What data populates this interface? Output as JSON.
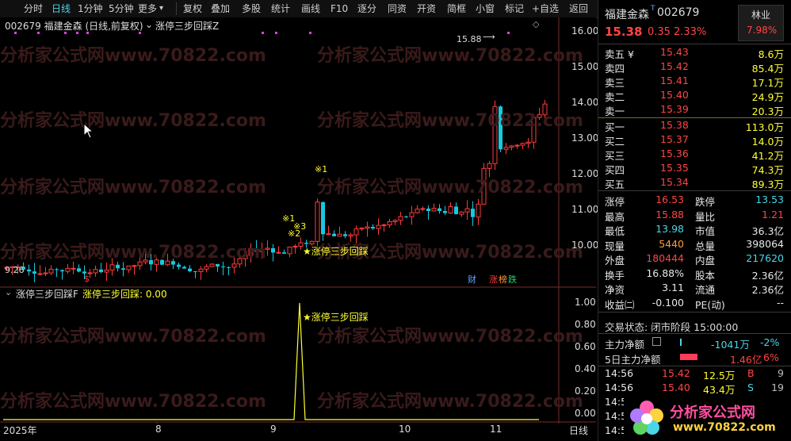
{
  "toolbar": {
    "items": [
      "分时",
      "日线",
      "1分钟",
      "5分钟",
      "更多",
      "复权",
      "叠加",
      "多股",
      "统计",
      "画线",
      "F10",
      "逐分",
      "同资",
      "开资",
      "简框",
      "小窗",
      "标记",
      "+自选",
      "返回"
    ],
    "more_arrow": "▾",
    "active_index": 1
  },
  "chart": {
    "header": "002679 福建金森 (日线,前复权)",
    "indicator_name": "涨停三步回踩Z",
    "dots_symbol": "◇",
    "y_ticks": [
      "16.00",
      "15.00",
      "14.00",
      "13.00",
      "12.00",
      "11.00",
      "10.00"
    ],
    "high_mark": "15.88",
    "low_mark": "9.26",
    "markers": {
      "m1a": "※1",
      "m1b": "※1",
      "m2": "※2",
      "m3": "※3",
      "star_label": "★涨停三步回踩",
      "s_mark": "$"
    },
    "tags": {
      "cai": "财",
      "zhang": "涨",
      "bang": "榜",
      "die": "跌"
    },
    "watermark": "分析家公式网www.70822.com"
  },
  "sub": {
    "title": "涨停三步回踩F",
    "value_label": "涨停三步回踩: 0.00",
    "y_ticks": [
      "1.00",
      "0.80",
      "0.60",
      "0.40",
      "0.20",
      "0.00"
    ],
    "star_label": "★涨停三步回踩"
  },
  "xaxis": {
    "labels": [
      "2025年",
      "8",
      "9",
      "10",
      "11"
    ],
    "mode": "日线"
  },
  "stock": {
    "name": "福建金森",
    "badge": "T",
    "code": "002679",
    "sector": "林业",
    "sector_pct": "7.98%",
    "price": "15.38",
    "change": "0.35",
    "pct": "2.33%"
  },
  "orderbook": {
    "asks": [
      {
        "label": "卖五 ¥",
        "price": "15.43",
        "vol": "8.6万"
      },
      {
        "label": "卖四",
        "price": "15.42",
        "vol": "85.4万"
      },
      {
        "label": "卖三",
        "price": "15.41",
        "vol": "17.1万"
      },
      {
        "label": "卖二",
        "price": "15.40",
        "vol": "24.9万"
      },
      {
        "label": "卖一",
        "price": "15.39",
        "vol": "20.3万"
      }
    ],
    "bids": [
      {
        "label": "买一",
        "price": "15.38",
        "vol": "113.0万"
      },
      {
        "label": "买二",
        "price": "15.37",
        "vol": "14.0万"
      },
      {
        "label": "买三",
        "price": "15.36",
        "vol": "41.2万"
      },
      {
        "label": "买四",
        "price": "15.35",
        "vol": "74.3万"
      },
      {
        "label": "买五",
        "price": "15.34",
        "vol": "89.3万"
      }
    ]
  },
  "stats": [
    {
      "l1": "涨停",
      "v1": "16.53",
      "c1": "red",
      "l2": "跌停",
      "v2": "13.53",
      "c2": "cyan"
    },
    {
      "l1": "最高",
      "v1": "15.88",
      "c1": "red",
      "l2": "量比",
      "v2": "1.21",
      "c2": "red"
    },
    {
      "l1": "最低",
      "v1": "13.98",
      "c1": "cyan",
      "l2": "市值",
      "v2": "36.3亿",
      "c2": "white"
    },
    {
      "l1": "现量",
      "v1": "5440",
      "c1": "orange",
      "l2": "总量",
      "v2": "398064",
      "c2": "white"
    },
    {
      "l1": "外盘",
      "v1": "180444",
      "c1": "red",
      "l2": "内盘",
      "v2": "217620",
      "c2": "cyan"
    },
    {
      "l1": "换手",
      "v1": "16.88%",
      "c1": "white",
      "l2": "股本",
      "v2": "2.36亿",
      "c2": "white"
    },
    {
      "l1": "净资",
      "v1": "3.11",
      "c1": "white",
      "l2": "流通",
      "v2": "2.36亿",
      "c2": "white"
    },
    {
      "l1": "收益㈡",
      "v1": "-0.100",
      "c1": "white",
      "l2": "PE(动)",
      "v2": "--",
      "c2": "white"
    }
  ],
  "status": "交易状态: 闭市阶段 15:00:00",
  "fund": {
    "main_label": "主力净额",
    "main_val": "-1041万",
    "main_pct": "-2%",
    "five_label": "5日主力净额",
    "five_val": "1.46亿",
    "five_pct": "6%"
  },
  "ticks": [
    {
      "time": "14:56",
      "price": "15.42",
      "vol": "12.5万",
      "side": "B",
      "n": "9"
    },
    {
      "time": "14:56",
      "price": "15.40",
      "vol": "43.4万",
      "side": "S",
      "n": "19"
    },
    {
      "time": "14:5",
      "price": "",
      "vol": "",
      "side": "",
      "n": ""
    },
    {
      "time": "14:5",
      "price": "",
      "vol": "",
      "side": "",
      "n": ""
    },
    {
      "time": "14:5",
      "price": "",
      "vol": "",
      "side": "",
      "n": ""
    }
  ],
  "logo": {
    "text": "分析家公式网",
    "url": "www.70822.com"
  },
  "colors": {
    "up": "#ff3b3b",
    "down": "#17c9e0",
    "accent": "#ffff33",
    "bg": "#000000"
  }
}
